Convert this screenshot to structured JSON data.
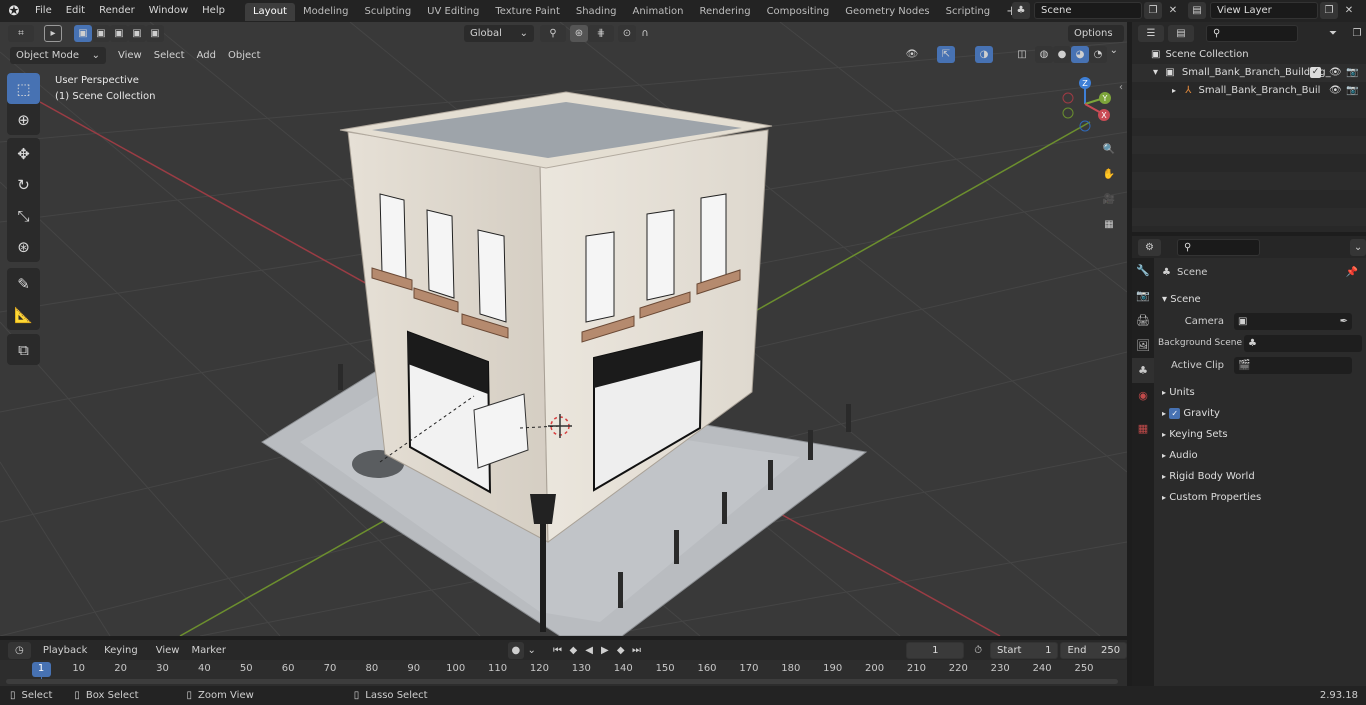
{
  "app": {
    "version": "2.93.18"
  },
  "menu": {
    "file": "File",
    "edit": "Edit",
    "render": "Render",
    "window": "Window",
    "help": "Help"
  },
  "workspaces": [
    "Layout",
    "Modeling",
    "Sculpting",
    "UV Editing",
    "Texture Paint",
    "Shading",
    "Animation",
    "Rendering",
    "Compositing",
    "Geometry Nodes",
    "Scripting"
  ],
  "workspace_add": "+",
  "scene_field": {
    "value": "Scene"
  },
  "view_layer_field": {
    "value": "View Layer"
  },
  "viewport": {
    "mode": "Object Mode",
    "menus": {
      "view": "View",
      "select": "Select",
      "add": "Add",
      "object": "Object"
    },
    "transform": "Global",
    "options": "Options",
    "overlay_title": "User Perspective",
    "overlay_collection": "(1) Scene Collection",
    "gizmo": {
      "x": "X",
      "y": "Y",
      "z": "Z"
    }
  },
  "outliner": {
    "root": "Scene Collection",
    "items": [
      {
        "label": "Small_Bank_Branch_Building_"
      },
      {
        "label": "Small_Bank_Branch_Buil"
      }
    ]
  },
  "properties": {
    "header": "Scene",
    "section_scene": "Scene",
    "camera_label": "Camera",
    "background_label": "Background Scene",
    "clip_label": "Active Clip",
    "sections": [
      "Units",
      "Gravity",
      "Keying Sets",
      "Audio",
      "Rigid Body World",
      "Custom Properties"
    ]
  },
  "timeline": {
    "menus": {
      "playback": "Playback",
      "keying": "Keying",
      "view": "View",
      "marker": "Marker"
    },
    "current_frame": "1",
    "start_label": "Start",
    "start": "1",
    "end_label": "End",
    "end": "250",
    "ticks": [
      "1",
      "10",
      "20",
      "30",
      "40",
      "50",
      "60",
      "70",
      "80",
      "90",
      "100",
      "110",
      "120",
      "130",
      "140",
      "150",
      "160",
      "170",
      "180",
      "190",
      "200",
      "210",
      "220",
      "230",
      "240",
      "250"
    ]
  },
  "status": {
    "select": "Select",
    "box_select": "Box Select",
    "zoom_view": "Zoom View",
    "lasso_select": "Lasso Select"
  },
  "colors": {
    "accent": "#4772b3",
    "x_axis": "#c94b55",
    "y_axis": "#7da53a",
    "z_axis": "#3e7fd6"
  }
}
